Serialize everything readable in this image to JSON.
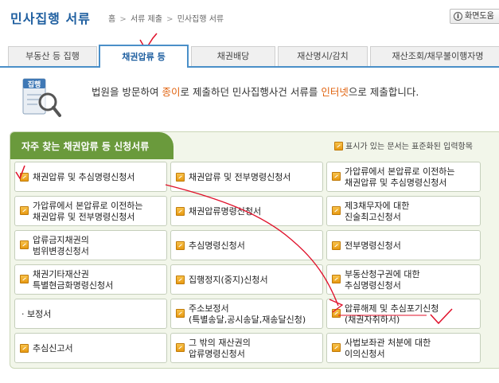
{
  "header": {
    "title": "민사집행 서류",
    "breadcrumb": [
      "홈",
      "서류 제출",
      "민사집행 서류"
    ],
    "breadcrumb_sep": ">",
    "help_label": "화면도움"
  },
  "tabs": [
    {
      "label": "부동산 등 집행",
      "active": false
    },
    {
      "label": "채권압류 등",
      "active": true
    },
    {
      "label": "채권배당",
      "active": false
    },
    {
      "label": "재산명시/감치",
      "active": false
    },
    {
      "label": "재산조회/채무불이행자명",
      "active": false
    }
  ],
  "intro": {
    "icon_label": "집행",
    "text_1": "법원을 방문하여 ",
    "text_hl_1": "종이",
    "text_2": "로 제출하던 민사집행사건 서류를 ",
    "text_hl_2": "인터넷",
    "text_3": "으로 제출합니다."
  },
  "panel": {
    "title": "자주 찾는 채권압류 등 신청서류",
    "legend": "표시가 있는 문서는 표준화된 입력항목"
  },
  "forms": [
    [
      "채권압류 및 추심명령신청서",
      "채권압류 및 전부명령신청서",
      "가압류에서 본압류로 이전하는\n채권압류 및 추심명령신청서"
    ],
    [
      "가압류에서 본압류로 이전하는\n채권압류 및 전부명령신청서",
      "채권압류명령신청서",
      "제3채무자에 대한\n진술최고신청서"
    ],
    [
      "압류금지채권의\n범위변경신청서",
      "추심명령신청서",
      "전부명령신청서"
    ],
    [
      "채권기타재산권\n특별현금화명령신청서",
      "집행정지(중지)신청서",
      "부동산청구권에 대한\n추심명령신청서"
    ],
    [
      "· 보정서",
      "주소보정서\n(특별송달,공시송달,재송달신청)",
      "압류해제 및 추심포기신청\n(채권자취하서)"
    ],
    [
      "추심신고서",
      "그 밖의 재산권의\n압류명령신청서",
      "사법보좌관 처분에 대한\n이의신청서"
    ]
  ],
  "colors": {
    "accent": "#1f5fa0",
    "panel_header": "#6a9a3c",
    "highlight": "#e0620e",
    "annotation": "#e0102a"
  },
  "icons": [
    "help-icon",
    "document-magnifier-icon",
    "edit-document-icon"
  ]
}
